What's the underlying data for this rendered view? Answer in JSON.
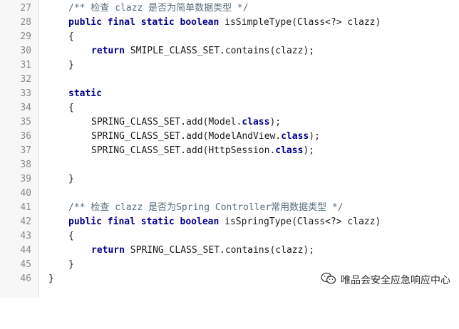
{
  "line_numbers": [
    "27",
    "28",
    "29",
    "30",
    "31",
    "32",
    "33",
    "34",
    "35",
    "36",
    "37",
    "38",
    "39",
    "40",
    "41",
    "42",
    "43",
    "44",
    "45",
    "46"
  ],
  "code": {
    "l27": {
      "comment": "/** 检查 clazz 是否为简单数据类型 */"
    },
    "l28": {
      "kw": "public final static boolean",
      "rest": " isSimpleType(Class<?> clazz)"
    },
    "l29": {
      "text": "{"
    },
    "l30": {
      "kw": "return",
      "rest": " SMIPLE_CLASS_SET.contains(clazz);"
    },
    "l31": {
      "text": "}"
    },
    "l32": {
      "text": ""
    },
    "l33": {
      "kw": "static"
    },
    "l34": {
      "text": "{"
    },
    "l35": {
      "pre": "SPRING_CLASS_SET.add(Model.",
      "kw": "class",
      "post": ");"
    },
    "l36": {
      "pre": "SPRING_CLASS_SET.add(ModelAndView.",
      "kw": "class",
      "post": ");"
    },
    "l37": {
      "pre": "SPRING_CLASS_SET.add(HttpSession.",
      "kw": "class",
      "post": ");"
    },
    "l38": {
      "text": ""
    },
    "l39": {
      "text": "}"
    },
    "l40": {
      "text": ""
    },
    "l41": {
      "comment": "/** 检查 clazz 是否为Spring Controller常用数据类型 */"
    },
    "l42": {
      "kw": "public final static boolean",
      "rest": " isSpringType(Class<?> clazz)"
    },
    "l43": {
      "text": "{"
    },
    "l44": {
      "kw": "return",
      "rest": " SPRING_CLASS_SET.contains(clazz);"
    },
    "l45": {
      "text": "}"
    },
    "l46": {
      "text": "}"
    }
  },
  "watermark": {
    "icon": "wechat-icon",
    "text": "唯品会安全应急响应中心"
  }
}
